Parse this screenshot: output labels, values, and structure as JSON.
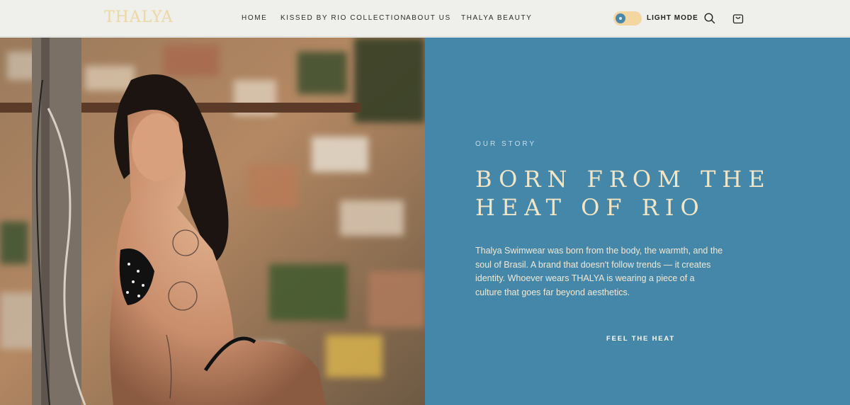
{
  "header": {
    "logo": "THALYA",
    "nav": [
      "HOME",
      "KISSED BY RIO COLLECTION",
      "ABOUT US",
      "THALYA BEAUTY"
    ],
    "mode_label": "LIGHT MODE",
    "icons": {
      "search": "search-icon",
      "cart": "shopping-bag-icon"
    }
  },
  "story": {
    "eyebrow": "OUR STORY",
    "title_line1": "BORN FROM THE",
    "title_line2": "HEAT OF RIO",
    "paragraph": "Thalya Swimwear was born from the body, the warmth, and the soul of Brasil. A brand that doesn't follow trends — it creates identity. Whoever wears THALYA is wearing a piece of a culture that goes far beyond aesthetics.",
    "cta": "FEEL THE HEAT"
  },
  "colors": {
    "story_bg": "#4587a8",
    "headline": "#f2e6c7",
    "logo": "#ecd9a8",
    "toggle_track": "#f3d6a0",
    "header_bg": "#efefec"
  }
}
